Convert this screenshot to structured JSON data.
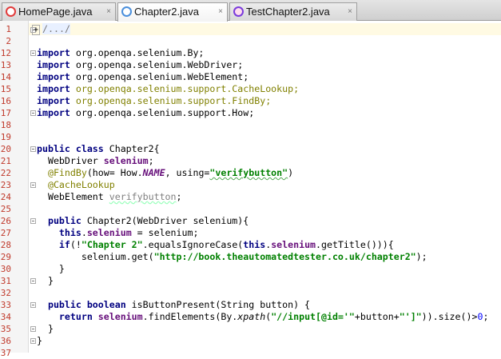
{
  "tabs": [
    {
      "label": "HomePage.java",
      "close": "×",
      "icon": "java-class-icon",
      "color": "#e23b3b"
    },
    {
      "label": "Chapter2.java",
      "close": "×",
      "icon": "java-class-icon",
      "color": "#4a8fdc"
    },
    {
      "label": "TestChapter2.java",
      "close": "×",
      "icon": "test-class-icon",
      "color": "#7a3bdc"
    }
  ],
  "line_numbers": [
    "1",
    "2",
    "12",
    "13",
    "14",
    "15",
    "16",
    "17",
    "18",
    "19",
    "20",
    "21",
    "22",
    "23",
    "24",
    "25",
    "26",
    "27",
    "28",
    "29",
    "30",
    "31",
    "32",
    "33",
    "34",
    "35",
    "36",
    "37"
  ],
  "code": {
    "l1": "/.../",
    "l13_a": "import",
    "l13_b": " org.openqa.selenium.By;",
    "l14_a": "import",
    "l14_b": " org.openqa.selenium.WebDriver;",
    "l15_a": "import",
    "l15_b": " org.openqa.selenium.WebElement;",
    "l16_a": "import",
    "l16_b": " org.openqa.selenium.support.CacheLookup;",
    "l17_a": "import",
    "l17_b": " org.openqa.selenium.support.FindBy;",
    "l18_a": "import",
    "l18_b": " org.openqa.selenium.support.How;",
    "l21_a": "public class",
    "l21_b": " Chapter2{",
    "l22_a": "  WebDriver ",
    "l22_b": "selenium",
    "l22_c": ";",
    "l23_a": "  @FindBy",
    "l23_b": "(how= How.",
    "l23_c": "NAME",
    "l23_d": ", using=",
    "l23_e": "\"verifybutton\"",
    "l23_f": ")",
    "l24_a": "  @CacheLookup",
    "l25_a": "  WebElement ",
    "l25_b": "verifybutton",
    "l25_c": ";",
    "l27_a": "  public",
    "l27_b": " Chapter2(WebDriver selenium){",
    "l28_a": "    this",
    "l28_b": ".",
    "l28_c": "selenium",
    "l28_d": " = selenium;",
    "l29_a": "    if",
    "l29_b": "(!",
    "l29_c": "\"Chapter 2\"",
    "l29_d": ".equalsIgnoreCase(",
    "l29_e": "this",
    "l29_f": ".",
    "l29_g": "selenium",
    "l29_h": ".getTitle())){",
    "l30_a": "        selenium.get(",
    "l30_b": "\"http://book.theautomatedtester.co.uk/chapter2\"",
    "l30_c": ");",
    "l31": "    }",
    "l32": "  }",
    "l34_a": "  public boolean",
    "l34_b": " isButtonPresent(String button) {",
    "l35_a": "    return ",
    "l35_b": "selenium",
    "l35_c": ".findElements(By.",
    "l35_d": "xpath",
    "l35_e": "(",
    "l35_f": "\"//input[@id='\"",
    "l35_g": "+button+",
    "l35_h": "\"']\"",
    "l35_i": ")).size()>",
    "l35_j": "0",
    "l35_k": ";",
    "l36": "  }",
    "l37": "}"
  }
}
